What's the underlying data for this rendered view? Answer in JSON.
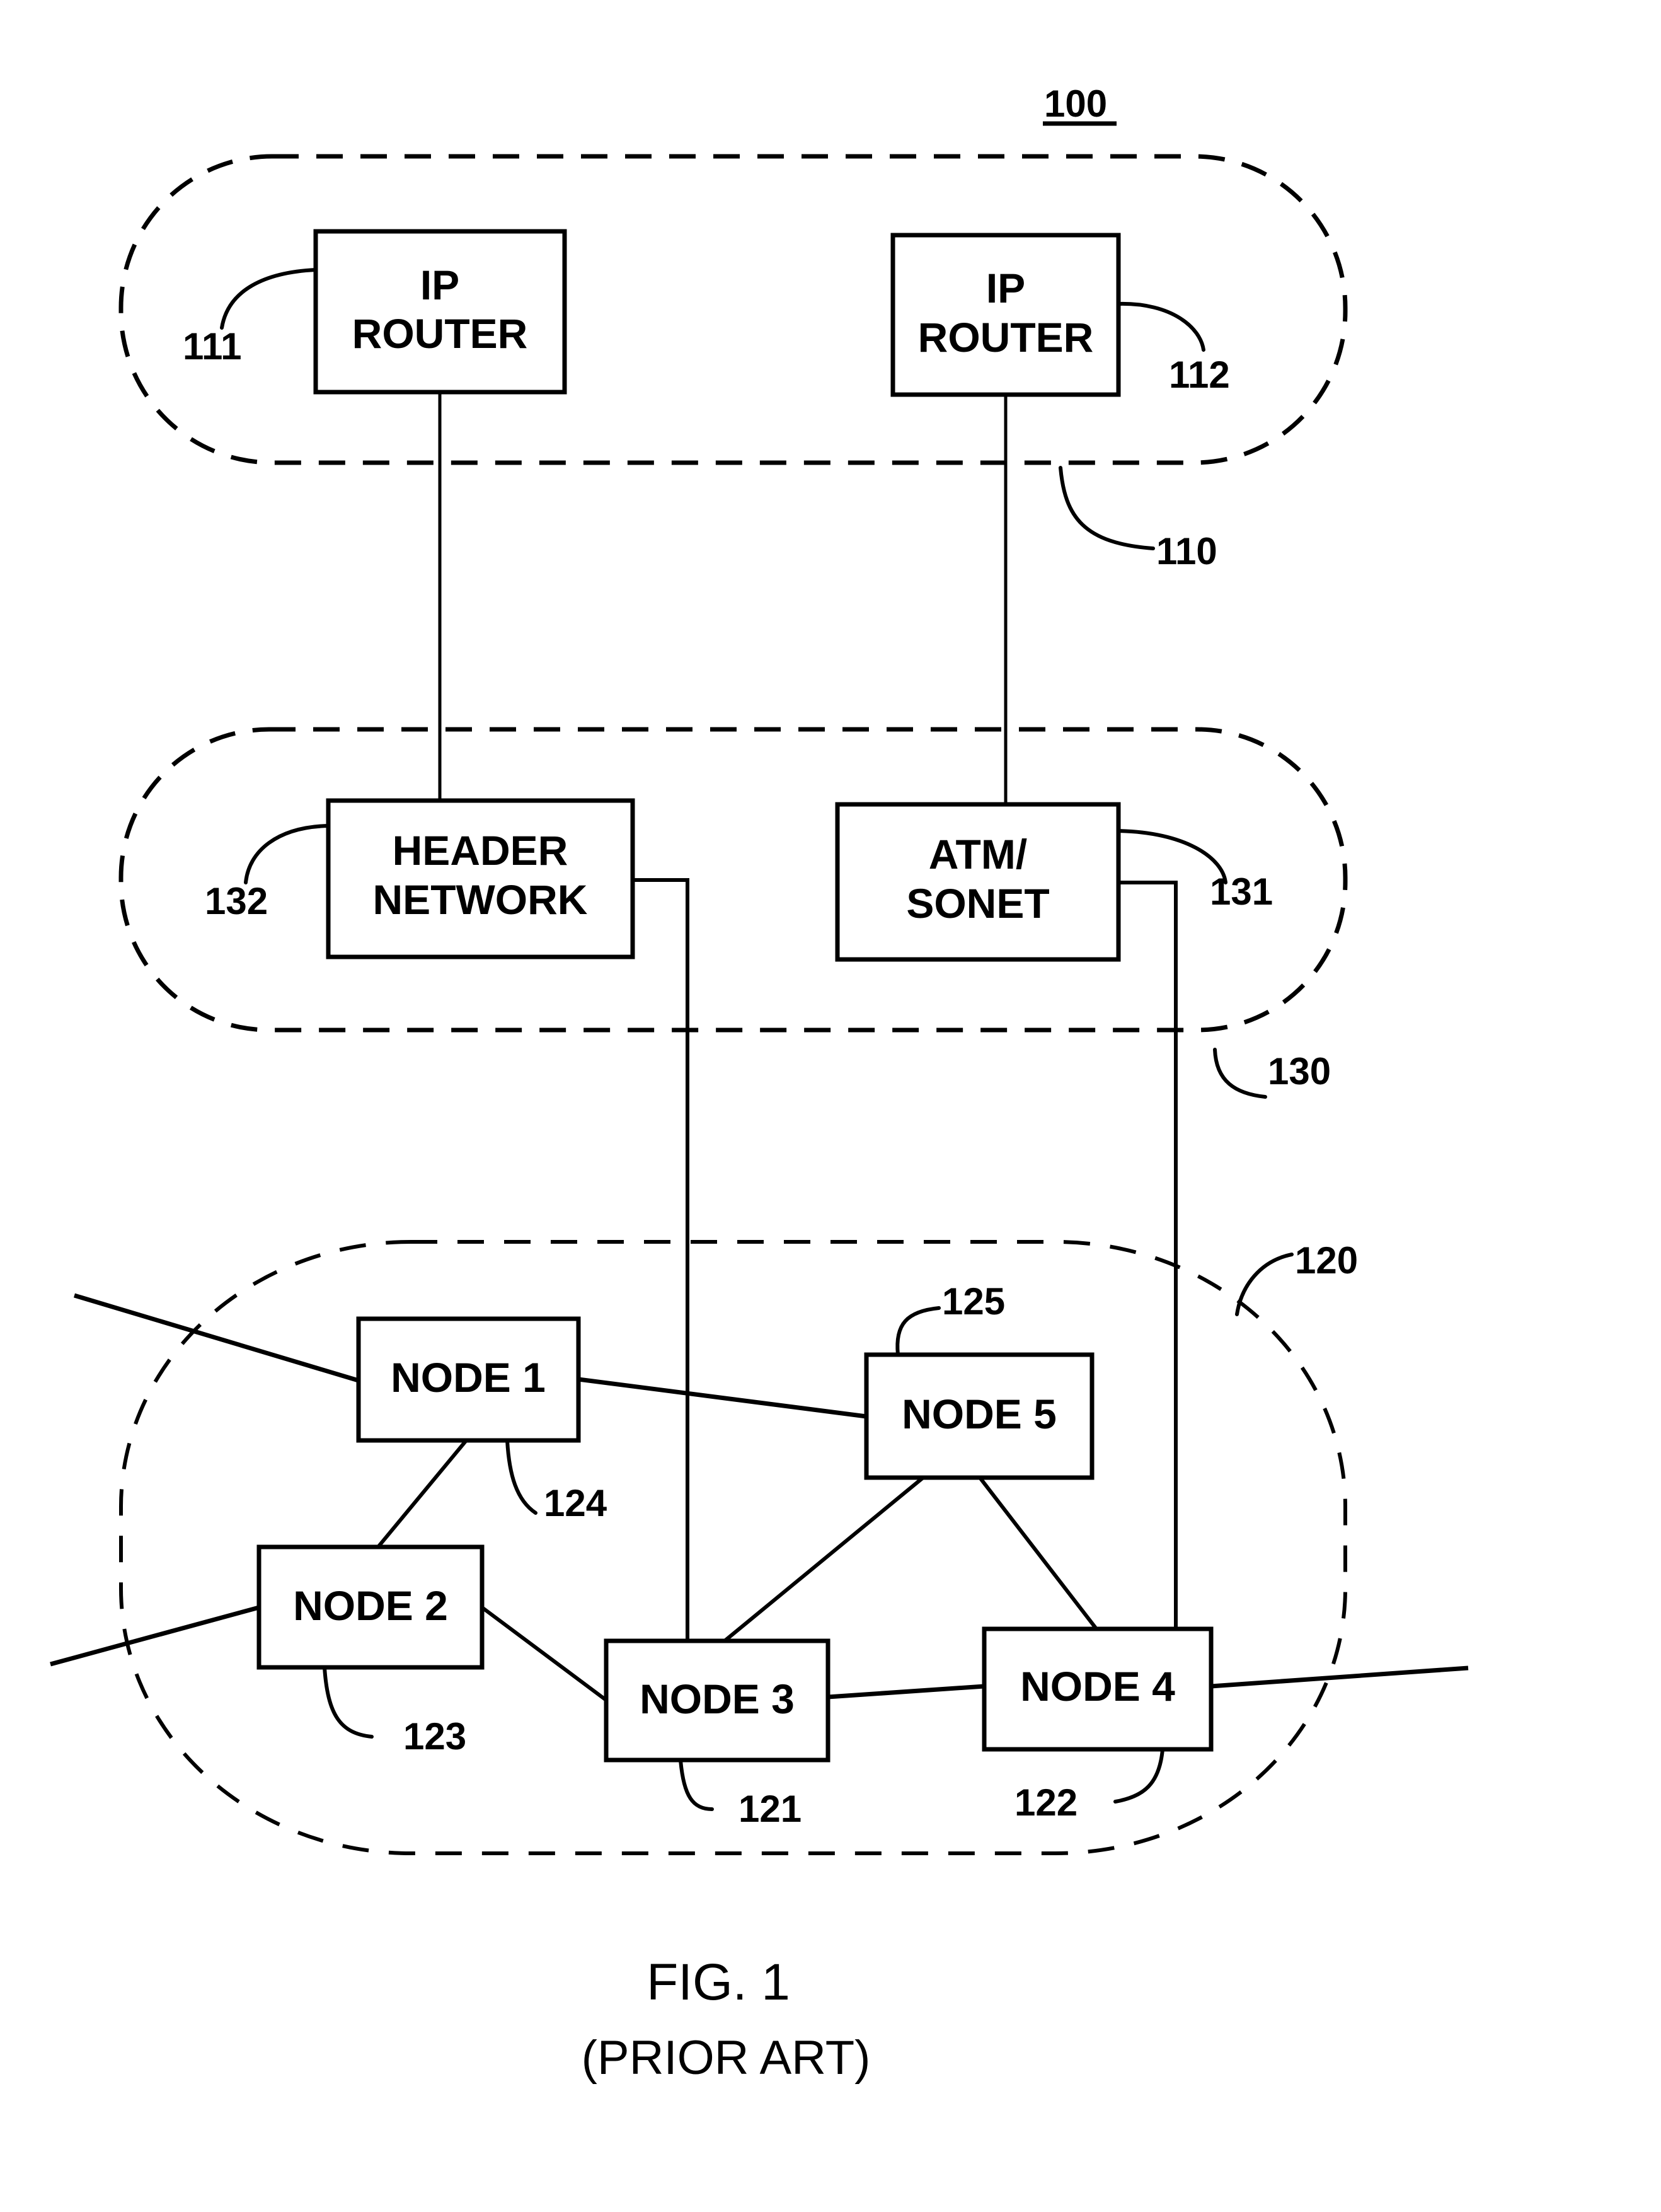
{
  "figure": {
    "reference_number": "100",
    "caption": "FIG. 1",
    "subcaption": "(PRIOR ART)"
  },
  "groups": [
    {
      "id": "ip-layer",
      "ref": "110"
    },
    {
      "id": "transport-layer",
      "ref": "130"
    },
    {
      "id": "optical-layer",
      "ref": "120"
    }
  ],
  "boxes": {
    "router_111": {
      "lines": [
        "IP",
        "ROUTER"
      ],
      "ref": "111"
    },
    "router_112": {
      "lines": [
        "IP",
        "ROUTER"
      ],
      "ref": "112"
    },
    "header_network": {
      "lines": [
        "HEADER",
        "NETWORK"
      ],
      "ref": "132"
    },
    "atm_sonet": {
      "lines": [
        "ATM/",
        "SONET"
      ],
      "ref": "131"
    },
    "node1": {
      "lines": [
        "NODE 1"
      ],
      "ref": "124"
    },
    "node2": {
      "lines": [
        "NODE 2"
      ],
      "ref": "123"
    },
    "node3": {
      "lines": [
        "NODE 3"
      ],
      "ref": "121"
    },
    "node4": {
      "lines": [
        "NODE 4"
      ],
      "ref": "122"
    },
    "node5": {
      "lines": [
        "NODE 5"
      ],
      "ref": "125"
    }
  },
  "connections": [
    [
      "router_111",
      "header_network"
    ],
    [
      "router_112",
      "atm_sonet"
    ],
    [
      "header_network",
      "node3"
    ],
    [
      "atm_sonet",
      "node4"
    ],
    [
      "node1",
      "node5"
    ],
    [
      "node1",
      "node2"
    ],
    [
      "node2",
      "node3"
    ],
    [
      "node3",
      "node4"
    ],
    [
      "node5",
      "node3"
    ],
    [
      "node5",
      "node4"
    ]
  ]
}
